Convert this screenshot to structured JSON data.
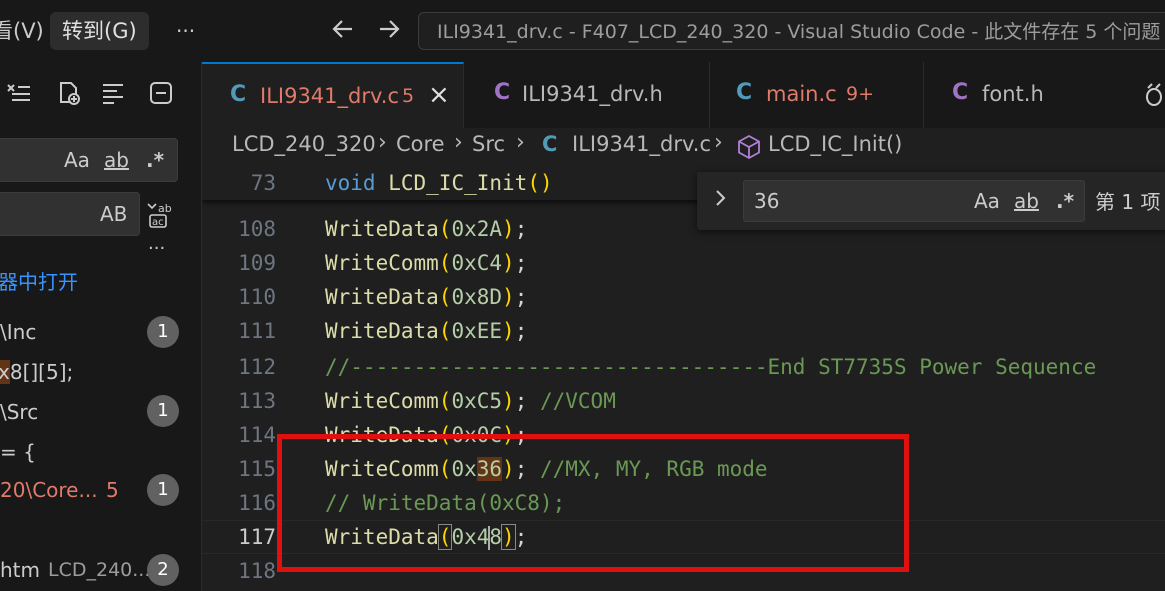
{
  "titlebar": {
    "menu_view": "看(V)",
    "menu_goto": "转到(G)",
    "more": "···",
    "back_icon": "arrow-left",
    "forward_icon": "arrow-right",
    "command_center": "ILI9341_drv.c - F407_LCD_240_320 - Visual Studio Code - 此文件存在 5 个问题"
  },
  "sidebar": {
    "search_toggle_icons": [
      "clear-results-icon",
      "new-search-editor-icon",
      "collapse-all-icon",
      "view-as-tree-icon"
    ],
    "search_options": {
      "match_case": "Aa",
      "whole_word": "ab",
      "regex": ".*"
    },
    "replace_option": "AB",
    "open_in_editor": "器中打开",
    "results": [
      {
        "path": "\\Inc",
        "count": "1"
      },
      {
        "match_prefix": "",
        "match_highlight": "x",
        "match_suffix": "8[][5];"
      },
      {
        "path": "\\Src",
        "count": "1"
      },
      {
        "match": "= {"
      },
      {
        "path": "20\\Core...",
        "problems": "5",
        "count": "1"
      },
      {
        "path": "htm",
        "sub": "LCD_240...",
        "count": "2"
      }
    ]
  },
  "tabs": [
    {
      "icon": "C",
      "name": "ILI9341_drv.c",
      "badge": "5",
      "close": "×",
      "active": true
    },
    {
      "icon": "C",
      "name": "ILI9341_drv.h",
      "active": false
    },
    {
      "icon": "C",
      "name": "main.c",
      "badge": "9+",
      "active": false
    },
    {
      "icon": "C",
      "name": "font.h",
      "active": false
    }
  ],
  "breadcrumb": {
    "items": [
      "LCD_240_320",
      "Core",
      "Src",
      "ILI9341_drv.c",
      "LCD_IC_Init()"
    ],
    "file_icon": "C",
    "symbol_icon": "cube-icon"
  },
  "find": {
    "value": "36",
    "match_case": "Aa",
    "whole_word": "ab",
    "regex": ".*",
    "count": "第 1 项"
  },
  "editor": {
    "sticky": {
      "ln": "73",
      "kw": "void",
      "fn": "LCD_IC_Init",
      "parens": "()"
    },
    "lines": [
      {
        "ln": "108",
        "fn": "WriteData",
        "arg": "0x2A",
        "tail": ";"
      },
      {
        "ln": "109",
        "fn": "WriteComm",
        "arg": "0xC4",
        "tail": ";"
      },
      {
        "ln": "110",
        "fn": "WriteData",
        "arg": "0x8D",
        "tail": ";"
      },
      {
        "ln": "111",
        "fn": "WriteData",
        "arg": "0xEE",
        "tail": ";"
      },
      {
        "ln": "112",
        "comment": "//---------------------------------End ST7735S Power Sequence"
      },
      {
        "ln": "113",
        "fn": "WriteComm",
        "arg": "0xC5",
        "tail": "; ",
        "comment": "//VCOM"
      },
      {
        "ln": "114",
        "fn": "WriteData",
        "arg": "0x0C",
        "tail": ";"
      },
      {
        "ln": "115",
        "fn": "WriteComm",
        "arg_pre": "0x",
        "arg_hl": "36",
        "tail": "; ",
        "comment": "//MX, MY, RGB mode"
      },
      {
        "ln": "116",
        "comment": "// WriteData(0xC8);"
      },
      {
        "ln": "117",
        "fn": "WriteData",
        "arg_pre": "0x4",
        "arg_post": "8",
        "tail": ";"
      },
      {
        "ln": "118"
      }
    ]
  },
  "colors": {
    "accent": "#0078d4",
    "annotation_box": "#e01010",
    "find_highlight": "#623315"
  }
}
